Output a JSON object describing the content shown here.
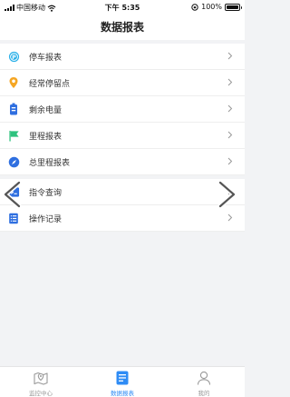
{
  "status": {
    "carrier": "中国移动",
    "time": "下午 5:35",
    "battery": "100%",
    "battery_level": 1.0
  },
  "nav": {
    "title": "数据报表"
  },
  "menu": [
    {
      "label": "停车报表",
      "icon": "parking-icon"
    },
    {
      "label": "经常停留点",
      "icon": "location-pin-icon"
    },
    {
      "label": "剩余电量",
      "icon": "battery-icon"
    },
    {
      "label": "里程报表",
      "icon": "flag-icon"
    },
    {
      "label": "总里程报表",
      "icon": "compass-icon"
    }
  ],
  "menu2": [
    {
      "label": "指令查询",
      "icon": "command-icon"
    },
    {
      "label": "操作记录",
      "icon": "list-icon"
    }
  ],
  "tabs": [
    {
      "label": "监控中心",
      "icon": "map-location-icon",
      "active": false
    },
    {
      "label": "数据报表",
      "icon": "report-icon",
      "active": true
    },
    {
      "label": "我的",
      "icon": "user-icon",
      "active": false
    }
  ],
  "colors": {
    "accent": "#2f8cf5",
    "parking": "#2ab0e8",
    "stay": "#f5a623",
    "battery": "#2f6fe0",
    "mileage": "#2ec27e",
    "total": "#2f6fe0"
  }
}
